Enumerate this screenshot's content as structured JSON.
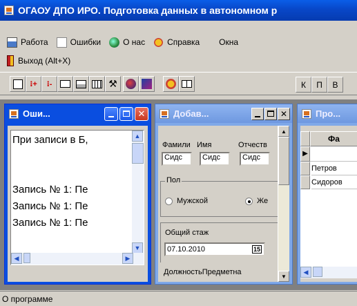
{
  "app": {
    "title": "ОГАОУ ДПО ИРО. Подготовка данных в автономном р"
  },
  "menu": {
    "items": [
      {
        "label": "Работа",
        "icon": "work-icon"
      },
      {
        "label": "Ошибки",
        "icon": "errors-icon"
      },
      {
        "label": "О нас",
        "icon": "globe-icon"
      },
      {
        "label": "Справка",
        "icon": "help-icon"
      },
      {
        "label": "Окна",
        "icon": ""
      }
    ],
    "exit_label": "Выход (Alt+X)"
  },
  "toolbar": {
    "letters": [
      "К",
      "П",
      "В"
    ]
  },
  "errors_window": {
    "title": "Оши...",
    "lines": [
      "При записи в Б,",
      "",
      "",
      "Запись № 1: Пе",
      "Запись № 1: Пе",
      "Запись № 1: Пе"
    ]
  },
  "add_window": {
    "title": "Добав...",
    "surname_label": "Фамили",
    "name_label": "Имя",
    "patronymic_label": "Отчеств",
    "surname_value": "Сидс",
    "name_value": "Сидс",
    "patronymic_value": "Сидс",
    "gender_label": "Пол",
    "male_label": "Мужской",
    "female_label": "Же",
    "experience_label": "Общий стаж",
    "experience_date": "07.10.2010",
    "calendar_label": "15",
    "bottom_label": "ДолжностьПредметна"
  },
  "browse_window": {
    "title": "Про...",
    "column_header": "Фа",
    "rows": [
      "Петров",
      "Сидоров"
    ]
  },
  "status": {
    "text": "О программе"
  },
  "colors": {
    "title_blue": "#0a5ee8",
    "close_red": "#d04a30",
    "background": "#d4d0c8"
  }
}
